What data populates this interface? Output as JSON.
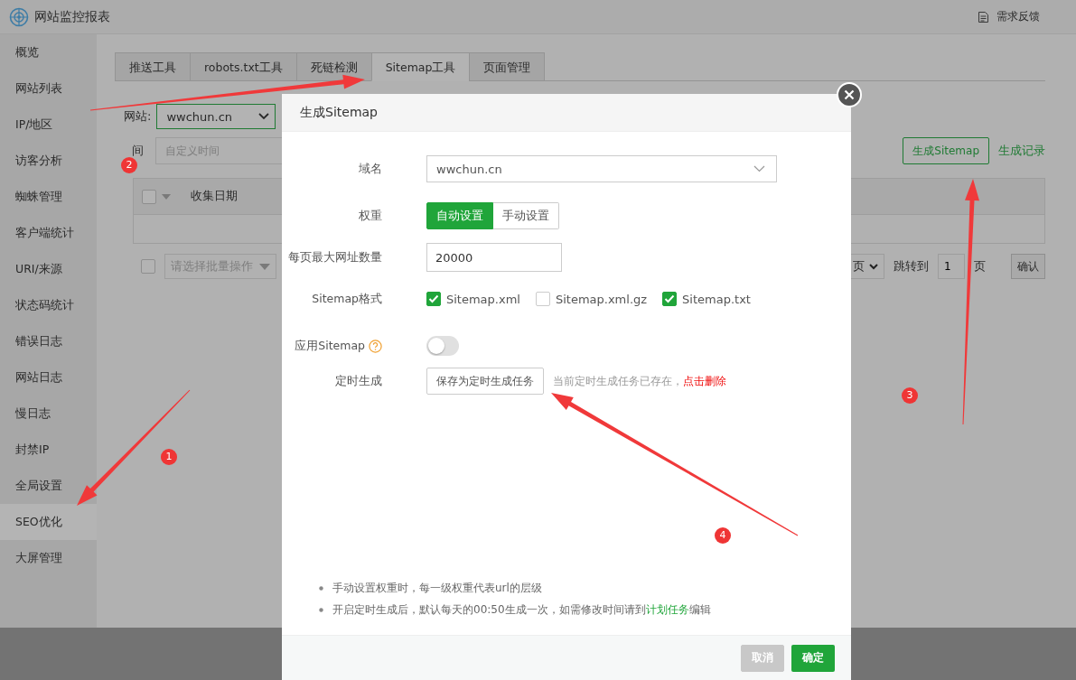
{
  "app": {
    "title": "网站监控报表",
    "feedback": "需求反馈"
  },
  "sidebar": {
    "items": [
      {
        "label": "概览",
        "selected": false
      },
      {
        "label": "网站列表",
        "selected": false
      },
      {
        "label": "IP/地区",
        "selected": false
      },
      {
        "label": "访客分析",
        "selected": false
      },
      {
        "label": "蜘蛛管理",
        "selected": false
      },
      {
        "label": "客户端统计",
        "selected": false
      },
      {
        "label": "URI/来源",
        "selected": false
      },
      {
        "label": "状态码统计",
        "selected": false
      },
      {
        "label": "错误日志",
        "selected": false
      },
      {
        "label": "网站日志",
        "selected": false
      },
      {
        "label": "慢日志",
        "selected": false
      },
      {
        "label": "封禁IP",
        "selected": false
      },
      {
        "label": "全局设置",
        "selected": false
      },
      {
        "label": "SEO优化",
        "selected": true
      },
      {
        "label": "大屏管理",
        "selected": false
      }
    ]
  },
  "tabs": [
    {
      "label": "推送工具",
      "selected": false
    },
    {
      "label": "robots.txt工具",
      "selected": false
    },
    {
      "label": "死链检测",
      "selected": false
    },
    {
      "label": "Sitemap工具",
      "selected": true
    },
    {
      "label": "页面管理",
      "selected": false
    }
  ],
  "filters": {
    "site_label": "网站:",
    "site_value": "wwchun.cn",
    "time_label": "间",
    "time_placeholder": "自定义时间"
  },
  "actions": {
    "generate": "生成Sitemap",
    "history": "生成记录"
  },
  "table": {
    "select_all_checked": false,
    "columns": [
      "收集日期"
    ]
  },
  "bulk": {
    "checked": false,
    "placeholder": "请选择批量操作"
  },
  "pager": {
    "page_size": "页",
    "goto_label": "跳转到",
    "page": "1",
    "page_suffix": "页",
    "confirm": "确认"
  },
  "dialog": {
    "title": "生成Sitemap",
    "fields": [
      {
        "kind": "select",
        "label": "域名",
        "value": "wwchun.cn"
      },
      {
        "kind": "segmented",
        "label": "权重",
        "options": [
          {
            "label": "自动设置",
            "selected": true
          },
          {
            "label": "手动设置",
            "selected": false
          }
        ]
      },
      {
        "kind": "input",
        "label": "每页最大网址数量",
        "value": "20000"
      },
      {
        "kind": "checkboxes",
        "label": "Sitemap格式",
        "options": [
          {
            "label": "Sitemap.xml",
            "checked": true
          },
          {
            "label": "Sitemap.xml.gz",
            "checked": false
          },
          {
            "label": "Sitemap.txt",
            "checked": true
          }
        ]
      },
      {
        "kind": "toggle",
        "label": "应用Sitemap",
        "help": true,
        "on": false
      },
      {
        "kind": "schedule",
        "label": "定时生成",
        "button": "保存为定时生成任务",
        "note": "当前定时生成任务已存在，",
        "link": "点击删除"
      }
    ],
    "notes": [
      {
        "text": "手动设置权重时，每一级权重代表url的层级"
      },
      {
        "text": "开启定时生成后，默认每天的00:50生成一次，如需修改时间请到",
        "link": "计划任务",
        "after": "编辑"
      }
    ],
    "cancel": {
      "label": "取消",
      "disabled": true
    },
    "ok": "确定"
  },
  "annotations": [
    {
      "label": "1"
    },
    {
      "label": "2"
    },
    {
      "label": "3"
    },
    {
      "label": "4"
    }
  ]
}
